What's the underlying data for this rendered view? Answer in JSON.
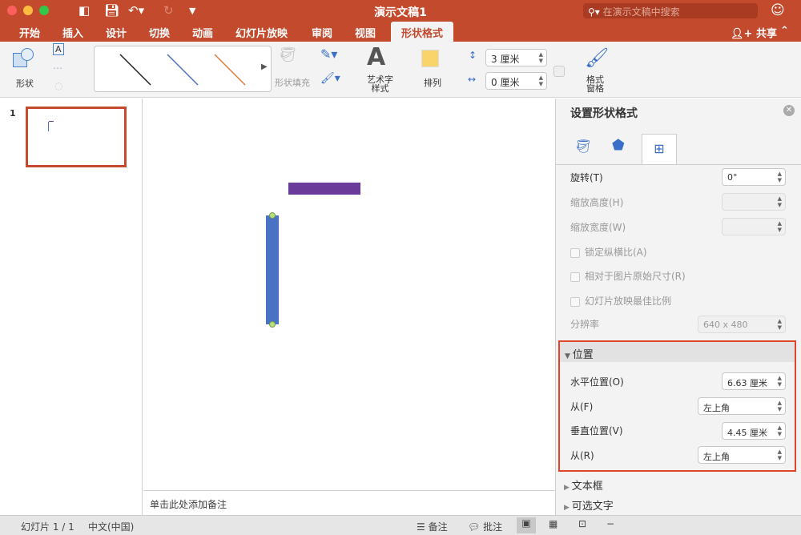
{
  "window": {
    "title": "演示文稿1",
    "search_placeholder": "在演示文稿中搜索"
  },
  "tabs": [
    "开始",
    "插入",
    "设计",
    "切换",
    "动画",
    "幻灯片放映",
    "审阅",
    "视图",
    "形状格式"
  ],
  "share_label": "共享",
  "ribbon": {
    "shapes_label": "形状",
    "shape_fill_label": "形状填充",
    "wordart_label": "艺术字\n样式",
    "wordart_l1": "艺术字",
    "wordart_l2": "样式",
    "arrange_label": "排列",
    "height_value": "3 厘米",
    "width_value": "0 厘米",
    "format_pane_l1": "格式",
    "format_pane_l2": "窗格",
    "line_colors": [
      "#222222",
      "#4a72c4",
      "#e07b3c"
    ]
  },
  "slides": {
    "number": "1"
  },
  "notes_placeholder": "单击此处添加备注",
  "pane": {
    "title": "设置形状格式",
    "rotation_label": "旋转(T)",
    "rotation_value": "0°",
    "scale_height_label": "缩放高度(H)",
    "scale_width_label": "缩放宽度(W)",
    "lock_aspect_label": "锁定纵横比(A)",
    "relative_original_label": "相对于图片原始尺寸(R)",
    "best_scale_label": "幻灯片放映最佳比例",
    "resolution_label": "分辨率",
    "resolution_value": "640 x 480",
    "position_header": "位置",
    "horizontal_label": "水平位置(O)",
    "horizontal_value": "6.63 厘米",
    "from_h_label": "从(F)",
    "from_h_value": "左上角",
    "vertical_label": "垂直位置(V)",
    "vertical_value": "4.45 厘米",
    "from_v_label": "从(R)",
    "from_v_value": "左上角",
    "textbox_header": "文本框",
    "alt_text_header": "可选文字"
  },
  "status": {
    "slide": "幻灯片 1 / 1",
    "language": "中文(中国)",
    "notes": "备注",
    "comments": "批注"
  },
  "colors": {
    "brand": "#c44a2d",
    "purple_shape": "#6a3b99",
    "blue_shape": "#4a72c4",
    "highlight": "#e0452b"
  }
}
